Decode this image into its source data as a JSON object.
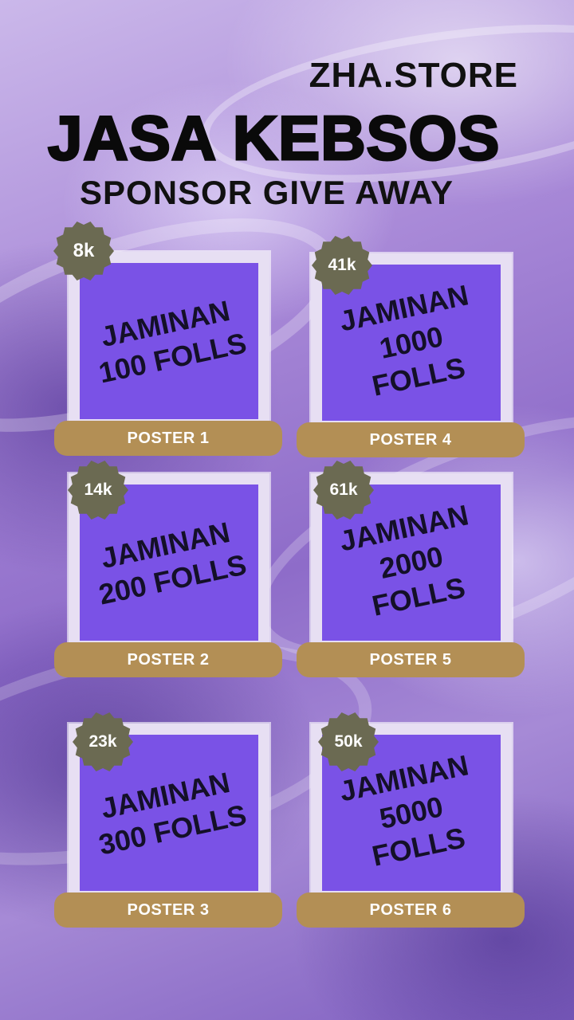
{
  "header": {
    "store_name": "ZHA.STORE",
    "title": "JASA KEBSOS",
    "subtitle": "SPONSOR GIVE AWAY"
  },
  "colors": {
    "panel": "#7a52e6",
    "label": "#b38f55",
    "badge": "#6b6a52"
  },
  "posters": [
    {
      "badge": "8k",
      "text": "JAMINAN\n100 FOLLS",
      "label": "POSTER 1"
    },
    {
      "badge": "41k",
      "text": "JAMINAN\n1000\nFOLLS",
      "label": "POSTER 4"
    },
    {
      "badge": "14k",
      "text": "JAMINAN\n200 FOLLS",
      "label": "POSTER 2"
    },
    {
      "badge": "61k",
      "text": "JAMINAN\n2000\nFOLLS",
      "label": "POSTER 5"
    },
    {
      "badge": "23k",
      "text": "JAMINAN\n300 FOLLS",
      "label": "POSTER 3"
    },
    {
      "badge": "50k",
      "text": "JAMINAN\n5000\nFOLLS",
      "label": "POSTER 6"
    }
  ]
}
